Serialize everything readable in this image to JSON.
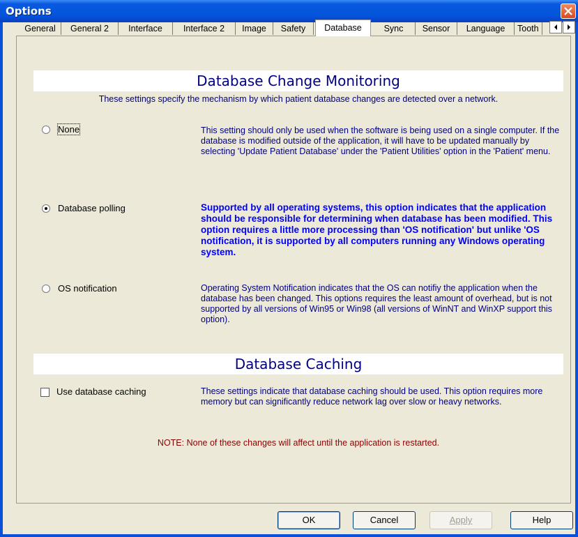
{
  "window": {
    "title": "Options"
  },
  "tabs": [
    {
      "label": "General"
    },
    {
      "label": "General 2"
    },
    {
      "label": "Interface"
    },
    {
      "label": "Interface 2"
    },
    {
      "label": "Image"
    },
    {
      "label": "Safety"
    },
    {
      "label": "Database"
    },
    {
      "label": "Sync"
    },
    {
      "label": "Sensor"
    },
    {
      "label": "Language"
    },
    {
      "label": "Tooth"
    }
  ],
  "active_tab": "Database",
  "monitoring": {
    "heading": "Database Change Monitoring",
    "subtitle": "These settings specify the mechanism by which patient database changes are detected over a network.",
    "options": [
      {
        "label": "None",
        "selected": false,
        "description": "This setting should only be used when the software is being used on a single computer.  If the database is modified outside of the application, it will have to be updated manually by selecting 'Update Patient Database' under the 'Patient Utilities' option in the 'Patient' menu."
      },
      {
        "label": "Database polling",
        "selected": true,
        "description": "Supported by all operating systems, this option indicates that the application should be responsible for determining when database has been modified.  This option requires a little more processing than 'OS notification' but unlike 'OS notification, it is supported by all computers running any Windows operating system."
      },
      {
        "label": "OS notification",
        "selected": false,
        "description": "Operating System Notification indicates that the OS can notifiy the application when the database has been changed.  This options requires the least amount of overhead, but is not supported by all versions of Win95 or Win98 (all versions of WinNT and WinXP support this option)."
      }
    ]
  },
  "caching": {
    "heading": "Database Caching",
    "checkbox_label": "Use database caching",
    "checked": false,
    "description": "These settings indicate that database caching should be used.  This option requires more memory but can significantly reduce network lag over slow or heavy networks."
  },
  "note": "NOTE: None of these changes will affect until the application is restarted.",
  "buttons": {
    "ok": "OK",
    "cancel": "Cancel",
    "apply": "Apply",
    "help": "Help"
  },
  "colors": {
    "heading": "#000080",
    "highlight": "#0000ff",
    "note": "#8b0000",
    "titlebar": "#0454dc"
  }
}
